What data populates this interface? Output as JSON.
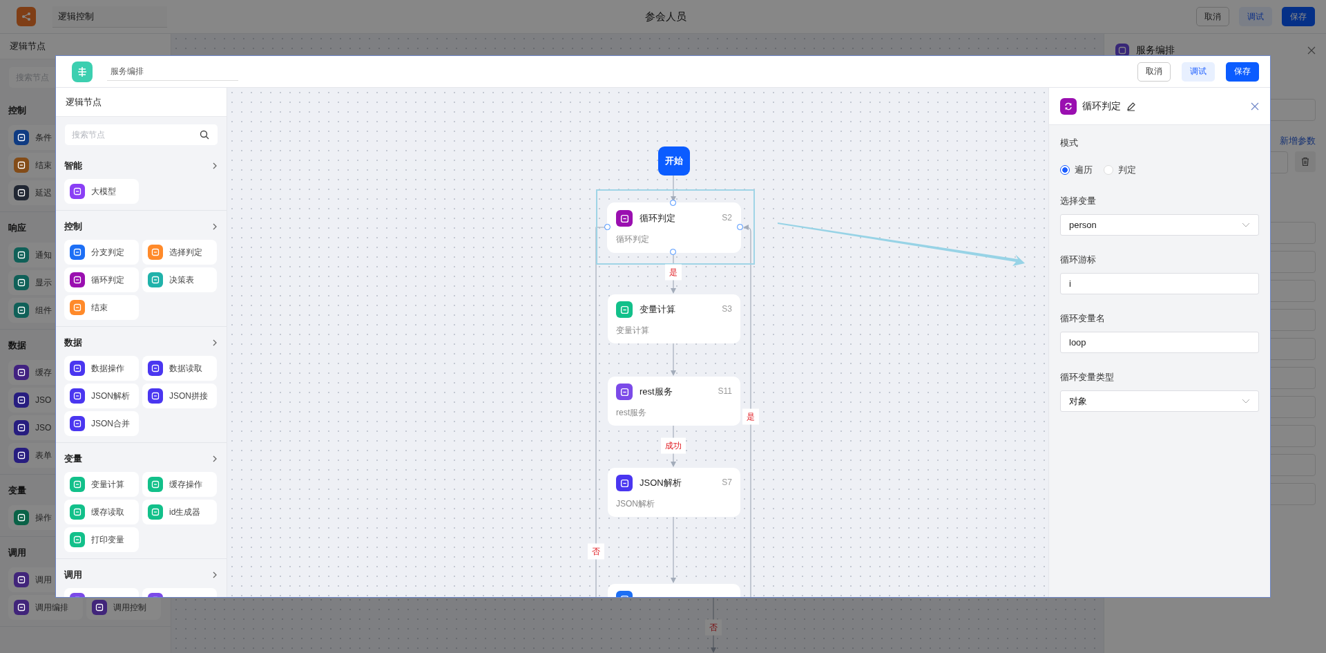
{
  "app": {
    "title_field": "逻辑控制",
    "page_title": "参会人员",
    "buttons": [
      {
        "label": "取消",
        "kind": "default"
      },
      {
        "label": "调试",
        "kind": "secondary"
      },
      {
        "label": "保存",
        "kind": "primary"
      }
    ]
  },
  "sidebar": {
    "title": "逻辑节点",
    "search": {
      "placeholder": "搜索节点"
    },
    "groups": [
      {
        "title": "控制",
        "rows": [
          [
            {
              "label": "条件",
              "color": "#0f3b82"
            }
          ],
          [
            {
              "label": "结束",
              "color": "#834c18"
            }
          ],
          [
            {
              "label": "延迟",
              "color": "#212733"
            }
          ]
        ]
      },
      {
        "title": "响应",
        "rows": [
          [
            {
              "label": "通知",
              "color": "#106058"
            }
          ],
          [
            {
              "label": "显示",
              "color": "#106058"
            }
          ],
          [
            {
              "label": "组件",
              "color": "#106058"
            }
          ]
        ]
      },
      {
        "title": "数据",
        "rows": [
          [
            {
              "label": "缓存",
              "color": "#412180"
            }
          ],
          [
            {
              "label": "JSO",
              "color": "#271d7f"
            }
          ],
          [
            {
              "label": "JSO",
              "color": "#271d7f"
            }
          ],
          [
            {
              "label": "表单",
              "color": "#271d7f"
            }
          ]
        ]
      },
      {
        "title": "变量",
        "rows": [
          [
            {
              "label": "操作",
              "color": "#0a6247"
            }
          ]
        ]
      },
      {
        "title": "调用",
        "rows": [
          [
            {
              "label": "调用",
              "color": "#41257a"
            }
          ],
          [
            {
              "label": "调用编排",
              "color": "#41257a"
            },
            {
              "label": "调用控制",
              "color": "#41257a"
            }
          ]
        ]
      }
    ]
  },
  "canvas": {
    "edge_labels": [
      "否"
    ]
  },
  "right_panel": {
    "title": "服务编排",
    "rows": [
      {
        "kind": "input"
      },
      {
        "kind": "link",
        "label": "新增参数"
      },
      {
        "kind": "select"
      },
      {
        "kind": "input"
      },
      {
        "kind": "input"
      },
      {
        "kind": "input"
      },
      {
        "kind": "input"
      },
      {
        "kind": "input"
      },
      {
        "kind": "input"
      },
      {
        "kind": "input"
      },
      {
        "kind": "input"
      },
      {
        "kind": "input"
      },
      {
        "kind": "input"
      }
    ]
  },
  "dialog": {
    "title_field": "服务编排",
    "buttons": [
      {
        "label": "取消",
        "kind": "default"
      },
      {
        "label": "调试",
        "kind": "secondary"
      },
      {
        "label": "保存",
        "kind": "primary"
      }
    ],
    "sidebar": {
      "title": "逻辑节点",
      "search": {
        "placeholder": "搜索节点"
      },
      "groups": [
        {
          "title": "智能",
          "items": [
            {
              "label": "大模型",
              "color": "#8a3ff5"
            }
          ]
        },
        {
          "title": "控制",
          "items": [
            {
              "label": "分支判定",
              "color": "#1d6ff5"
            },
            {
              "label": "选择判定",
              "color": "#ff8a2a"
            },
            {
              "label": "循环判定",
              "color": "#9a0fb0"
            },
            {
              "label": "决策表",
              "color": "#20b2aa"
            },
            {
              "label": "结束",
              "color": "#ff8a2a"
            }
          ]
        },
        {
          "title": "数据",
          "items": [
            {
              "label": "数据操作",
              "color": "#4a36f0"
            },
            {
              "label": "数据读取",
              "color": "#4a36f0"
            },
            {
              "label": "JSON解析",
              "color": "#4a36f0"
            },
            {
              "label": "JSON拼接",
              "color": "#4a36f0"
            },
            {
              "label": "JSON合并",
              "color": "#4a36f0"
            }
          ]
        },
        {
          "title": "变量",
          "items": [
            {
              "label": "变量计算",
              "color": "#12c08a"
            },
            {
              "label": "缓存操作",
              "color": "#12c08a"
            },
            {
              "label": "缓存读取",
              "color": "#12c08a"
            },
            {
              "label": "id生成器",
              "color": "#12c08a"
            },
            {
              "label": "打印变量",
              "color": "#12c08a"
            }
          ]
        },
        {
          "title": "调用",
          "items": [
            {
              "color": "#7b4ae8"
            },
            {
              "color": "#7b4ae8"
            }
          ]
        }
      ]
    },
    "flow": {
      "start": "开始",
      "nodes": [
        {
          "title": "循环判定",
          "code": "S2",
          "subtitle": "循环判定",
          "color": "#9a0fb0",
          "selected": true
        },
        {
          "title": "变量计算",
          "code": "S3",
          "subtitle": "变量计算",
          "color": "#12c08a",
          "selected": false
        },
        {
          "title": "rest服务",
          "code": "S11",
          "subtitle": "rest服务",
          "color": "#7b4ae8",
          "selected": false
        },
        {
          "title": "JSON解析",
          "code": "S7",
          "subtitle": "JSON解析",
          "color": "#4a36f0",
          "selected": false
        },
        {
          "color": "#1d6ff5",
          "selected": false
        }
      ],
      "edge_labels": [
        "是",
        "成功",
        "是",
        "否"
      ]
    },
    "inspector": {
      "title": "循环判定",
      "color": "#9a0fb0",
      "mode_label": "模式",
      "modes": [
        {
          "label": "遍历",
          "selected": true
        },
        {
          "label": "判定",
          "selected": false
        }
      ],
      "fields": [
        {
          "label": "选择变量",
          "kind": "select",
          "value": "person"
        },
        {
          "label": "循环游标",
          "kind": "input",
          "value": "i"
        },
        {
          "label": "循环变量名",
          "kind": "input",
          "value": "loop"
        },
        {
          "label": "循环变量类型",
          "kind": "select",
          "value": "对象"
        }
      ]
    }
  }
}
